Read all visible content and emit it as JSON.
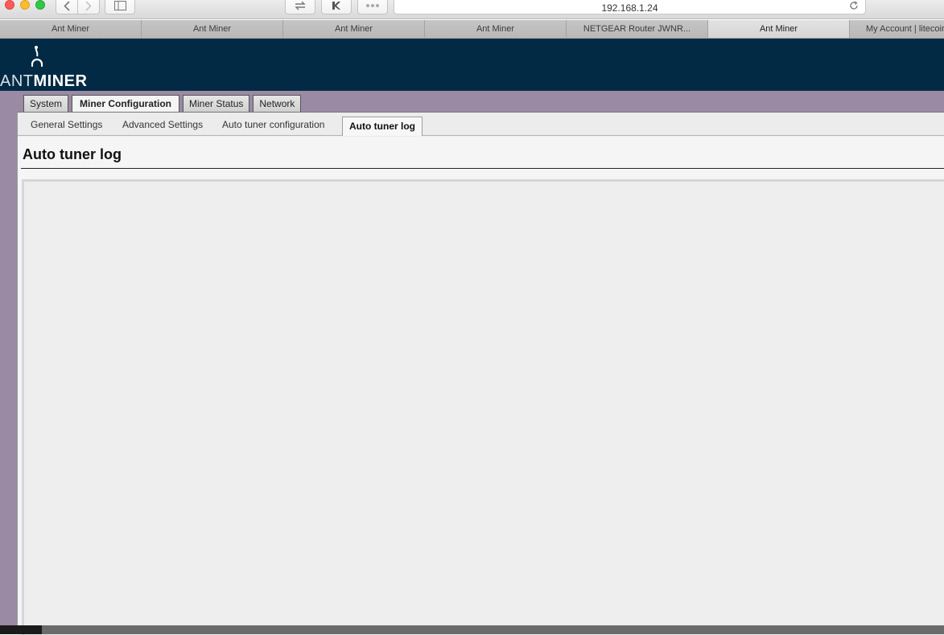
{
  "browser": {
    "address": "192.168.1.24",
    "tabs": [
      {
        "label": "Ant Miner",
        "active": false
      },
      {
        "label": "Ant Miner",
        "active": false
      },
      {
        "label": "Ant Miner",
        "active": false
      },
      {
        "label": "Ant Miner",
        "active": false
      },
      {
        "label": "NETGEAR Router JWNR...",
        "active": false
      },
      {
        "label": "Ant Miner",
        "active": true
      },
      {
        "label": "My Account | litecoir",
        "active": false
      }
    ],
    "icons": {
      "back": "chevron-left-icon",
      "forward": "chevron-right-icon",
      "sidebar": "sidebar-icon",
      "share": "share-icon",
      "extension": "extension-icon",
      "more": "dots-icon",
      "reload": "reload-icon"
    }
  },
  "header": {
    "logo_thin": "ANT",
    "logo_bold": "MINER",
    "background": "#022a44"
  },
  "nav": {
    "main_tabs": [
      {
        "label": "System",
        "active": false
      },
      {
        "label": "Miner Configuration",
        "active": true
      },
      {
        "label": "Miner Status",
        "active": false
      },
      {
        "label": "Network",
        "active": false
      }
    ],
    "sub_tabs": [
      {
        "label": "General Settings",
        "active": false
      },
      {
        "label": "Advanced Settings",
        "active": false
      },
      {
        "label": "Auto tuner configuration",
        "active": false
      },
      {
        "label": "Auto tuner log",
        "active": true
      }
    ]
  },
  "page": {
    "title": "Auto tuner log",
    "log_content": ""
  },
  "colors": {
    "purple": "#9a8aa4",
    "content": "#ececec"
  }
}
